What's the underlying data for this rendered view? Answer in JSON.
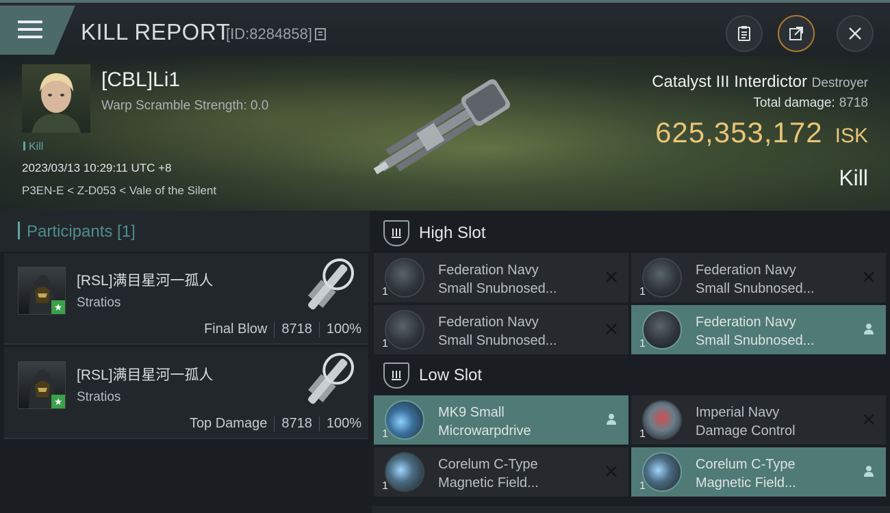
{
  "header": {
    "title": "KILL REPORT",
    "report_id": "[ID:8284858]",
    "icons": [
      "menu-icon",
      "copy-icon",
      "clipboard-icon",
      "share-icon",
      "close-icon"
    ]
  },
  "victim": {
    "name": "[CBL]Li1",
    "warp_scramble": "Warp Scramble Strength: 0.0",
    "kill_tag": "Kill",
    "datetime": "2023/03/13 10:29:11 UTC +8",
    "location": "P3EN-E < Z-D053 < Vale of the Silent",
    "ship_name": "Catalyst III Interdictor",
    "ship_class": "Destroyer",
    "total_damage_label": "Total damage:",
    "total_damage": "8718",
    "isk_value": "625,353,172",
    "isk_unit": "ISK",
    "result": "Kill"
  },
  "participants": {
    "title": "Participants [1]",
    "rows": [
      {
        "name": "[RSL]满目星河一孤人",
        "ship": "Stratios",
        "role": "Final Blow",
        "damage": "8718",
        "percent": "100%"
      },
      {
        "name": "[RSL]满目星河一孤人",
        "ship": "Stratios",
        "role": "Top Damage",
        "damage": "8718",
        "percent": "100%"
      }
    ]
  },
  "fitting": {
    "high_slot_label": "High Slot",
    "low_slot_label": "Low Slot",
    "high": [
      {
        "line1": "Federation Navy",
        "line2": "Small Snubnosed...",
        "qty": "1",
        "state": "destroyed"
      },
      {
        "line1": "Federation Navy",
        "line2": "Small Snubnosed...",
        "qty": "1",
        "state": "destroyed"
      },
      {
        "line1": "Federation Navy",
        "line2": "Small Snubnosed...",
        "qty": "1",
        "state": "destroyed"
      },
      {
        "line1": "Federation Navy",
        "line2": "Small Snubnosed...",
        "qty": "1",
        "state": "dropped"
      }
    ],
    "low": [
      {
        "line1": "MK9 Small",
        "line2": "Microwarpdrive",
        "qty": "1",
        "state": "dropped"
      },
      {
        "line1": "Imperial Navy",
        "line2": "Damage Control",
        "qty": "1",
        "state": "destroyed"
      },
      {
        "line1": "Corelum C-Type",
        "line2": "Magnetic Field...",
        "qty": "1",
        "state": "destroyed"
      },
      {
        "line1": "Corelum C-Type",
        "line2": "Magnetic Field...",
        "qty": "1",
        "state": "dropped"
      }
    ]
  },
  "colors": {
    "accent": "#5fa7a2",
    "isk": "#e9c476",
    "active_module": "#4f7a75"
  }
}
